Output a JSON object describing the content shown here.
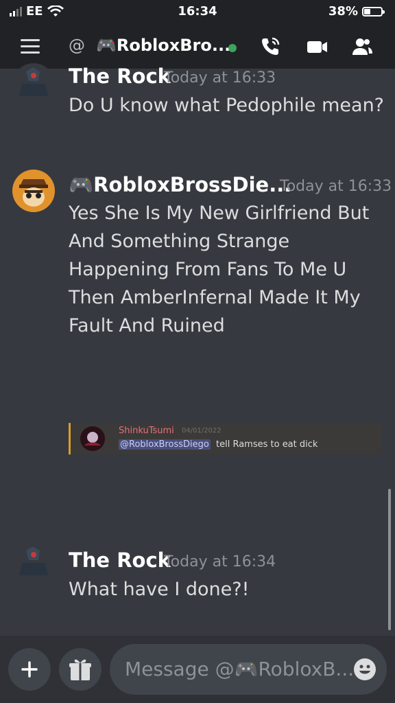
{
  "status_bar": {
    "carrier": "EE",
    "time": "16:34",
    "battery_percent": "38%",
    "battery_level": 0.38
  },
  "header": {
    "at_symbol": "@",
    "title": "🎮RobloxBro...",
    "online_status_color": "#3ba55d",
    "icons": [
      "menu-icon",
      "phone-call-icon",
      "video-icon",
      "members-icon"
    ]
  },
  "messages": [
    {
      "author": "The Rock",
      "timestamp": "Today at 16:33",
      "text": "Do U know what Pedophile mean?"
    },
    {
      "author": "🎮RobloxBrossDie...",
      "timestamp": "Today at 16:33",
      "text": "Yes She Is My New Girlfriend But And Something Strange Happening From Fans To Me U Then AmberInfernal Made It My Fault And Ruined"
    },
    {
      "author": "The Rock",
      "timestamp": "Today at 16:34",
      "text": "What have I done?!"
    }
  ],
  "embed": {
    "author": "ShinkuTsumi",
    "date": "04/01/2022",
    "mention": "@RobloxBrossDiego",
    "text": "tell Ramses to eat dick",
    "accent_color": "#d89f2a"
  },
  "composer": {
    "placeholder": "Message @🎮RobloxB...",
    "icons": [
      "plus-icon",
      "gift-icon",
      "emoji-icon"
    ]
  }
}
